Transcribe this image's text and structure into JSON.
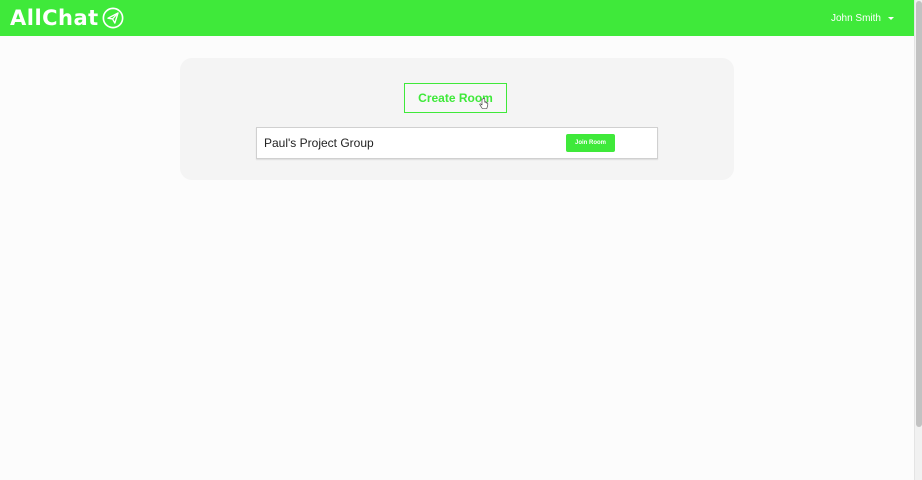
{
  "app": {
    "name": "AllChat",
    "logo_icon": "paper-plane-icon"
  },
  "colors": {
    "brand": "#3fe93a",
    "panel": "#f4f4f4",
    "background": "#fcfcfc"
  },
  "user": {
    "name": "John Smith"
  },
  "actions": {
    "create_room_label": "Create Room"
  },
  "rooms": [
    {
      "name": "Paul's Project Group",
      "join_label": "Join Room"
    }
  ]
}
